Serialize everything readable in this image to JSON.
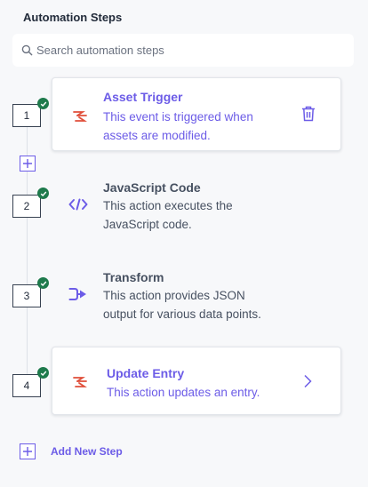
{
  "panel": {
    "title": "Automation Steps"
  },
  "search": {
    "placeholder": "Search automation steps"
  },
  "steps": [
    {
      "number": "1",
      "title": "Asset Trigger",
      "description": "This event is triggered when assets are modified.",
      "icon": "asset-trigger-icon",
      "status": "complete"
    },
    {
      "number": "2",
      "title": "JavaScript Code",
      "description": "This action executes the JavaScript code.",
      "icon": "code-icon",
      "status": "complete"
    },
    {
      "number": "3",
      "title": "Transform",
      "description": "This action provides JSON output for various data points.",
      "icon": "transform-icon",
      "status": "complete"
    },
    {
      "number": "4",
      "title": "Update Entry",
      "description": "This action updates an entry.",
      "icon": "update-entry-icon",
      "status": "complete"
    }
  ],
  "footer": {
    "add_step_label": "Add New Step"
  },
  "colors": {
    "accent": "#6c5ce7",
    "success": "#1e7a4c",
    "brand_red": "#e04f3a",
    "text": "#475161",
    "heading": "#222b3a"
  }
}
